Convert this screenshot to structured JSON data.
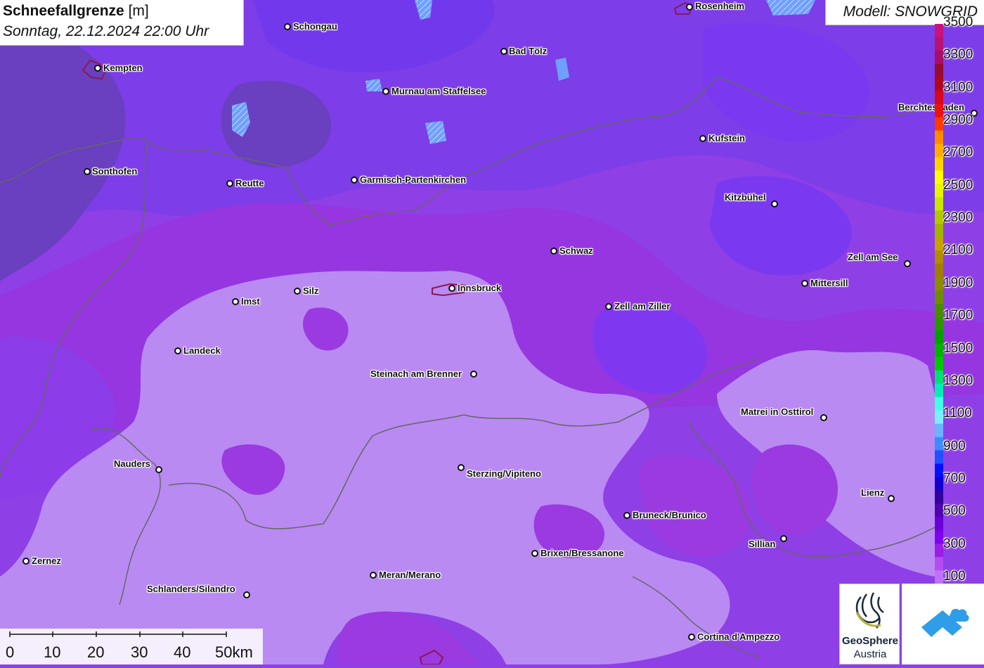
{
  "header": {
    "title": "Schneefallgrenze",
    "unit": "[m]",
    "datetime": "Sonntag, 22.12.2024 22:00 Uhr"
  },
  "model": {
    "label": "Modell: SNOWGRID"
  },
  "cities": [
    {
      "name": "Rosenheim"
    },
    {
      "name": "Schongau"
    },
    {
      "name": "Kempten"
    },
    {
      "name": "Bad Tölz"
    },
    {
      "name": "Murnau am Staffelsee"
    },
    {
      "name": "Berchtesgaden"
    },
    {
      "name": "Kufstein"
    },
    {
      "name": "Sonthofen"
    },
    {
      "name": "Reutte"
    },
    {
      "name": "Garmisch-Partenkirchen"
    },
    {
      "name": "Kitzbühel"
    },
    {
      "name": "Schwaz"
    },
    {
      "name": "Zell am See"
    },
    {
      "name": "Mittersill"
    },
    {
      "name": "Silz"
    },
    {
      "name": "Innsbruck"
    },
    {
      "name": "Imst"
    },
    {
      "name": "Zell am Ziller"
    },
    {
      "name": "Landeck"
    },
    {
      "name": "Steinach am Brenner"
    },
    {
      "name": "Matrei in Osttirol"
    },
    {
      "name": "Nauders"
    },
    {
      "name": "Sterzing/Vipiteno"
    },
    {
      "name": "Lienz"
    },
    {
      "name": "Bruneck/Brunico"
    },
    {
      "name": "Sillian"
    },
    {
      "name": "Brixen/Bressanone"
    },
    {
      "name": "Zernez"
    },
    {
      "name": "Meran/Merano"
    },
    {
      "name": "Schlanders/Silandro"
    },
    {
      "name": "Cortina d'Ampezzo"
    }
  ],
  "legend": {
    "labels": [
      "3500",
      "3300",
      "3100",
      "2900",
      "2700",
      "2500",
      "2300",
      "2100",
      "1900",
      "1700",
      "1500",
      "1300",
      "1100",
      "900",
      "700",
      "500",
      "300",
      "100"
    ],
    "colors": [
      "#c8137c",
      "#b81272",
      "#a80e68",
      "#960c2e",
      "#b0061e",
      "#d80818",
      "#f01010",
      "#ff3a00",
      "#ff8a00",
      "#ffae00",
      "#ffd400",
      "#ffff00",
      "#e6f500",
      "#c8e600",
      "#b4c800",
      "#a0b400",
      "#c8a000",
      "#b48c00",
      "#a07c00",
      "#8c8c00",
      "#6e8c00",
      "#4a8c00",
      "#2a9600",
      "#00a000",
      "#00b400",
      "#00c800",
      "#00e06e",
      "#00f0b4",
      "#40ffe6",
      "#7af0ff",
      "#6ab4ff",
      "#3c8cff",
      "#2050ff",
      "#0010ff",
      "#1000d0",
      "#3000a0",
      "#5000b0",
      "#6a00d8",
      "#8000f0",
      "#9a1ee6",
      "#b44cf0",
      "#c070ff"
    ]
  },
  "scale": {
    "labels": [
      "0",
      "10",
      "20",
      "30",
      "40",
      "50km"
    ]
  },
  "logos": {
    "geosphere_line1": "GeoSphere",
    "geosphere_line2": "Austria"
  }
}
